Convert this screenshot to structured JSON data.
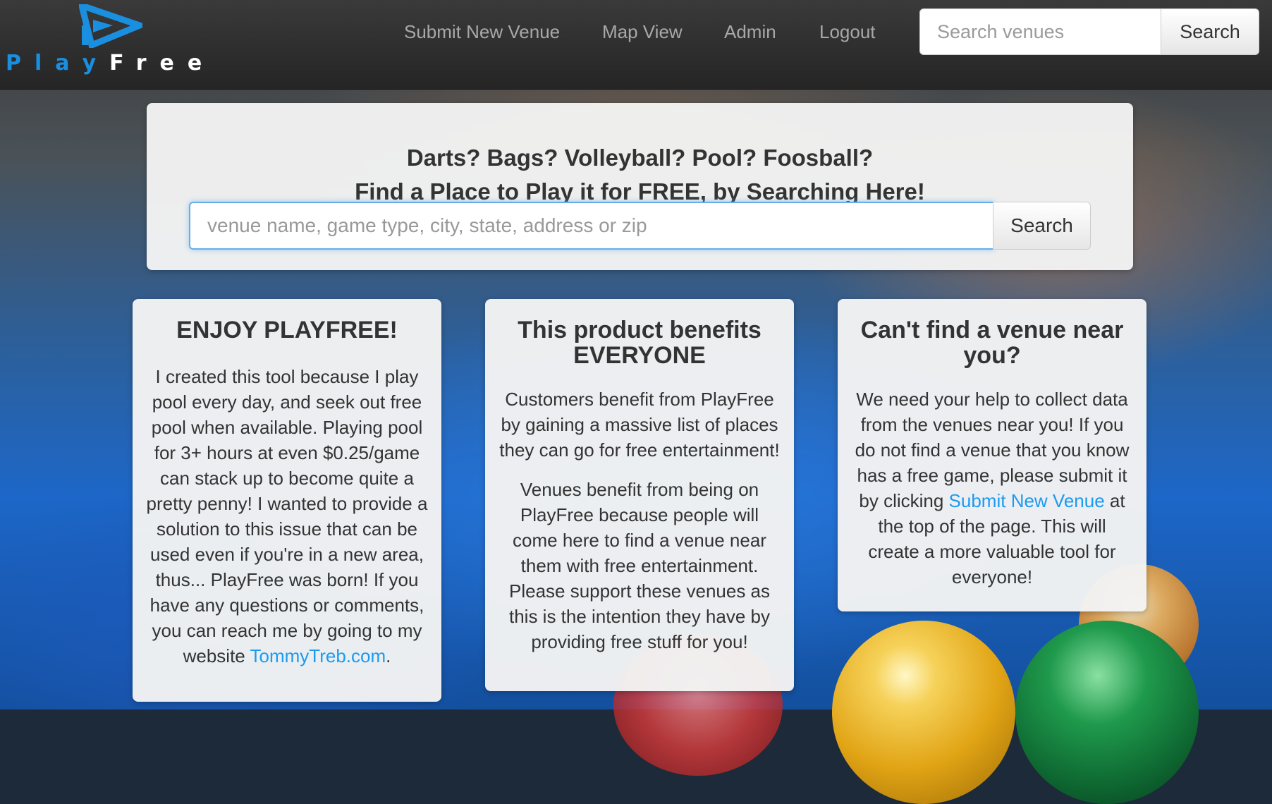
{
  "brand": {
    "play": "Play",
    "free": "Free",
    "accent_color": "#1a8fe0"
  },
  "nav": {
    "links": [
      "Submit New Venue",
      "Map View",
      "Admin",
      "Logout"
    ],
    "search_placeholder": "Search venues",
    "search_button": "Search"
  },
  "hero": {
    "line1": "Darts? Bags? Volleyball? Pool? Foosball?",
    "line2": "Find a Place to Play it for FREE, by Searching Here!",
    "search_placeholder": "venue name, game type, city, state, address or zip",
    "search_button": "Search"
  },
  "cards": [
    {
      "title": "ENJOY PLAYFREE!",
      "body": "I created this tool because I play pool every day, and seek out free pool when available. Playing pool for 3+ hours at even $0.25/game can stack up to become quite a pretty penny! I wanted to provide a solution to this issue that can be used even if you're in a new area, thus... PlayFree was born! If you have any questions or comments, you can reach me by going to my website ",
      "link": "TommyTreb.com",
      "after_link": "."
    },
    {
      "title": "This product benefits EVERYONE",
      "p1": "Customers benefit from PlayFree by gaining a massive list of places they can go for free entertainment!",
      "p2": "Venues benefit from being on PlayFree because people will come here to find a venue near them with free entertainment. Please support these venues as this is the intention they have by providing free stuff for you!"
    },
    {
      "title": "Can't find a venue near you?",
      "body_before": "We need your help to collect data from the venues near you! If you do not find a venue that you know has a free game, please submit it by clicking ",
      "link": "Submit New Venue",
      "body_after": " at the top of the page. This will create a more valuable tool for everyone!"
    }
  ]
}
